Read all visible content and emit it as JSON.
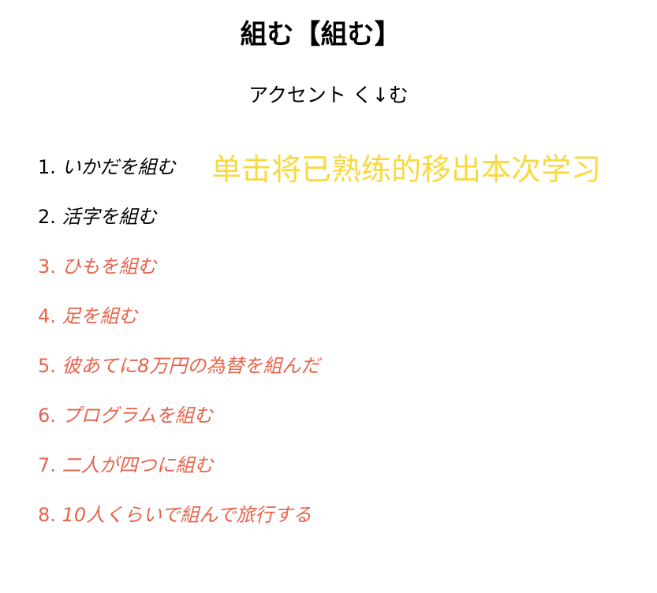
{
  "title": "組む【組む】",
  "accent_line": "アクセント く↓む",
  "banner_text": "单击将已熟练的移出本次学习",
  "colors": {
    "default_text": "#000000",
    "highlight_text": "#e8634a",
    "banner": "#f8d93e"
  },
  "examples": [
    {
      "num": "1.",
      "text": "いかだを組む",
      "state": "default"
    },
    {
      "num": "2.",
      "text": "活字を組む",
      "state": "default"
    },
    {
      "num": "3.",
      "text": "ひもを組む",
      "state": "highlight"
    },
    {
      "num": "4.",
      "text": "足を組む",
      "state": "highlight"
    },
    {
      "num": "5.",
      "text": "彼あてに8万円の為替を組んだ",
      "state": "highlight"
    },
    {
      "num": "6.",
      "text": "プログラムを組む",
      "state": "highlight"
    },
    {
      "num": "7.",
      "text": "二人が四つに組む",
      "state": "highlight"
    },
    {
      "num": "8.",
      "text": "10人くらいで組んで旅行する",
      "state": "highlight"
    }
  ]
}
